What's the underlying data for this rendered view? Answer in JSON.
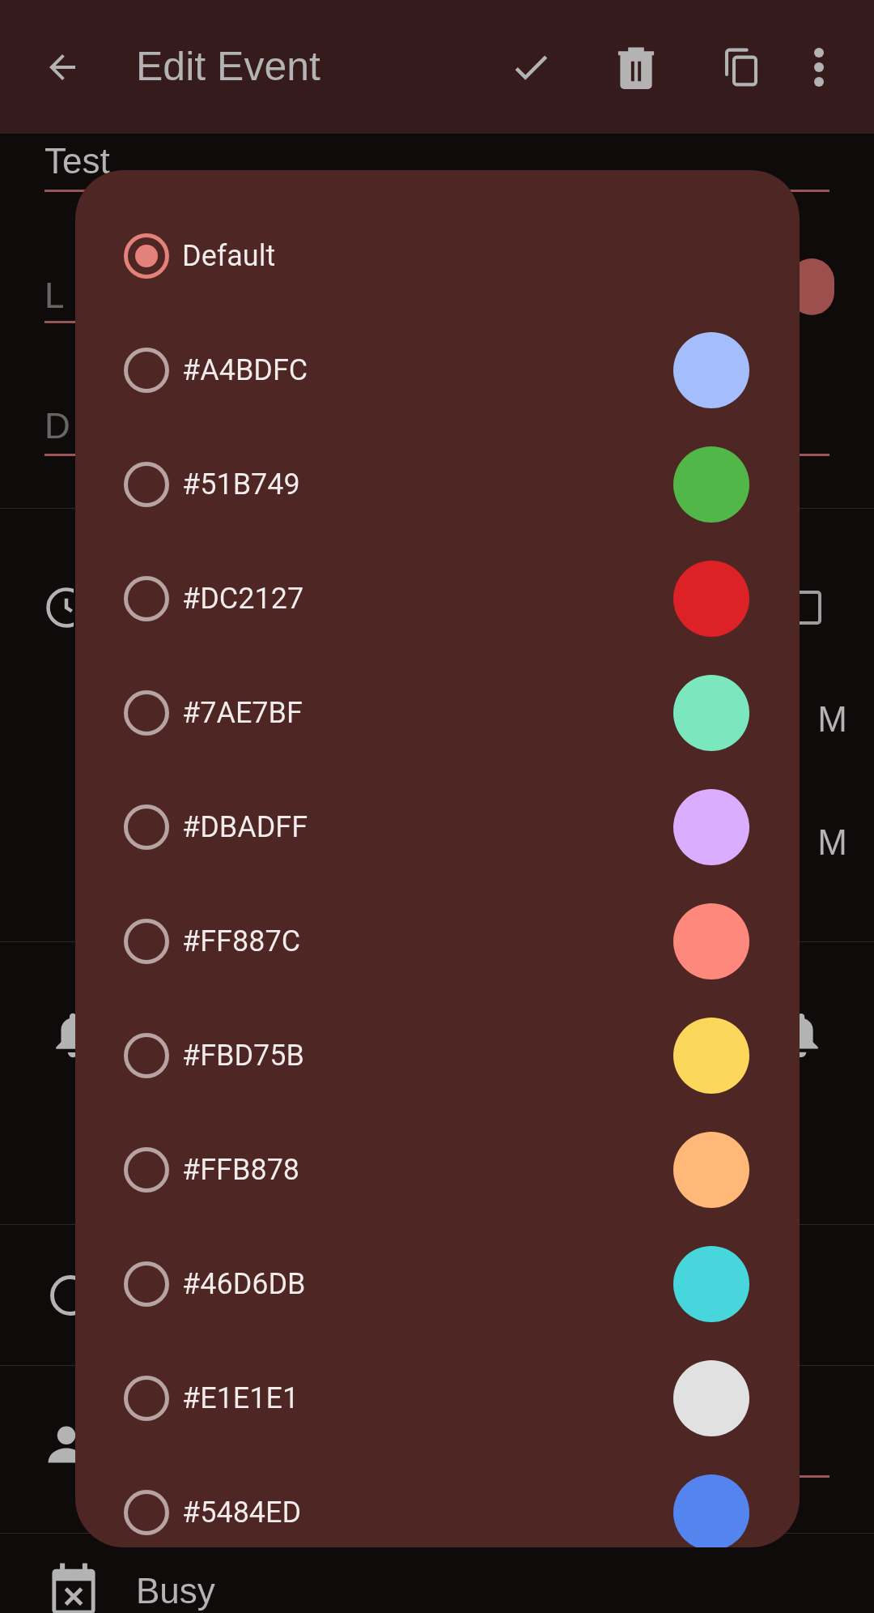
{
  "app_bar": {
    "title": "Edit Event"
  },
  "form": {
    "title_value": "Test",
    "location_placeholder": "L",
    "description_placeholder": "D",
    "all_day_checked": false,
    "time_fragments": [
      "M",
      "M"
    ],
    "availability": "Busy"
  },
  "color_dialog": {
    "options": [
      {
        "label": "Default",
        "selected": true
      },
      {
        "label": "#A4BDFC",
        "selected": false,
        "color": "#a4bdfc"
      },
      {
        "label": "#51B749",
        "selected": false,
        "color": "#51b749"
      },
      {
        "label": "#DC2127",
        "selected": false,
        "color": "#dc2127"
      },
      {
        "label": "#7AE7BF",
        "selected": false,
        "color": "#7ae7bf"
      },
      {
        "label": "#DBADFF",
        "selected": false,
        "color": "#dbadff"
      },
      {
        "label": "#FF887C",
        "selected": false,
        "color": "#ff887c"
      },
      {
        "label": "#FBD75B",
        "selected": false,
        "color": "#fbd75b"
      },
      {
        "label": "#FFB878",
        "selected": false,
        "color": "#ffb878"
      },
      {
        "label": "#46D6DB",
        "selected": false,
        "color": "#46d6db"
      },
      {
        "label": "#E1E1E1",
        "selected": false,
        "color": "#e1e1e1"
      },
      {
        "label": "#5484ED",
        "selected": false,
        "color": "#5484ed"
      }
    ]
  }
}
